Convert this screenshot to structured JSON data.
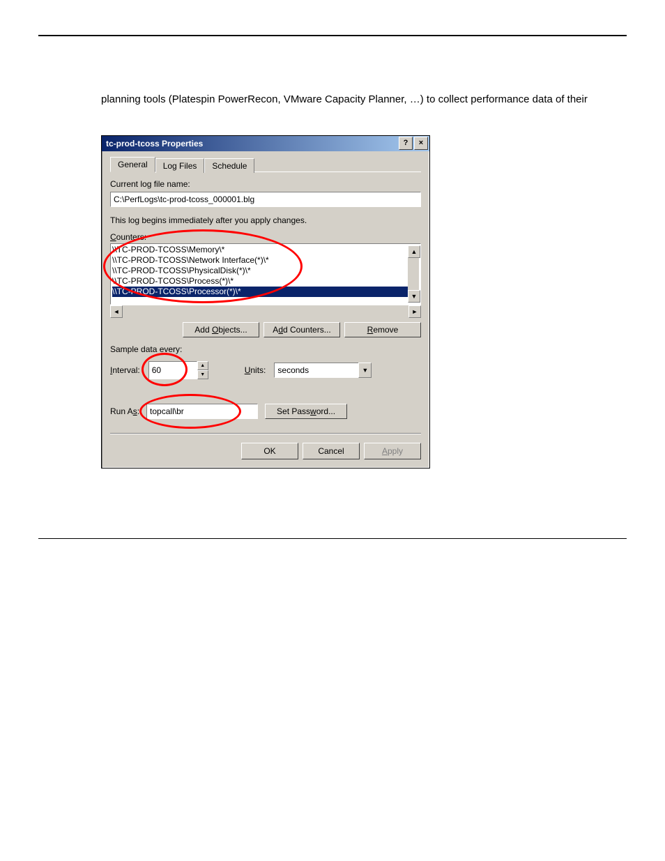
{
  "doc": {
    "intro_text": "planning tools (Platespin PowerRecon, VMware Capacity Planner, …) to collect performance data of their"
  },
  "dialog": {
    "title": "tc-prod-tcoss Properties",
    "tabs": {
      "general": "General",
      "logfiles": "Log Files",
      "schedule": "Schedule"
    },
    "current_log_label": "Current log file name:",
    "current_log_value": "C:\\PerfLogs\\tc-prod-tcoss_000001.blg",
    "note": "This log begins immediately after you apply changes.",
    "counters_label": "Counters:",
    "counter_items": [
      "\\\\TC-PROD-TCOSS\\Memory\\*",
      "\\\\TC-PROD-TCOSS\\Network Interface(*)\\*",
      "\\\\TC-PROD-TCOSS\\PhysicalDisk(*)\\*",
      "\\\\TC-PROD-TCOSS\\Process(*)\\*",
      "\\\\TC-PROD-TCOSS\\Processor(*)\\*"
    ],
    "buttons": {
      "add_objects": "Add Objects...",
      "add_counters": "Add Counters...",
      "remove": "Remove"
    },
    "sample_label": "Sample data every:",
    "interval_label": "Interval:",
    "interval_value": "60",
    "units_label": "Units:",
    "units_value": "seconds",
    "runas_label": "Run As:",
    "runas_value": "topcall\\br",
    "set_password": "Set Password...",
    "ok": "OK",
    "cancel": "Cancel",
    "apply": "Apply"
  }
}
